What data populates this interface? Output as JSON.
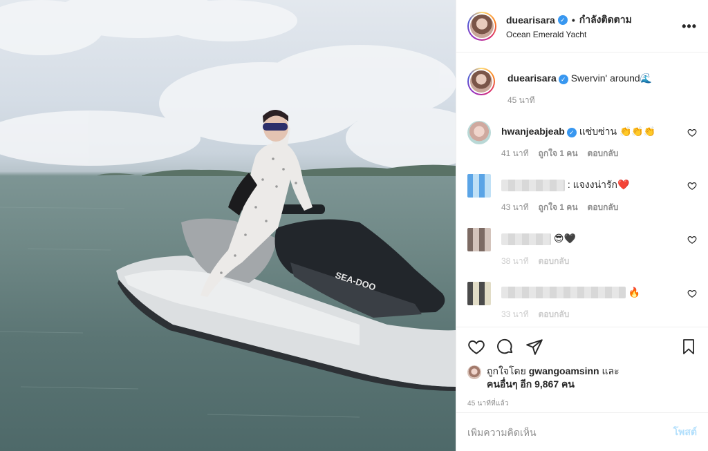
{
  "post": {
    "author": "duearisara",
    "follow_state": "กำลังติดตาม",
    "location": "Ocean Emerald Yacht",
    "caption": "Swervin' around🌊",
    "caption_time": "45 นาที"
  },
  "photo_overlay": {
    "jetski_brand": "SEA-DOO"
  },
  "comments": [
    {
      "user": "hwanjeabjeab",
      "text": "แซ่บซ่าน 👏👏👏",
      "time": "41 นาที",
      "likes": "ถูกใจ 1 คน",
      "reply": "ตอบกลับ"
    },
    {
      "user": "",
      "text": ": แจงงน่ารัก❤️",
      "time": "43 นาที",
      "likes": "ถูกใจ 1 คน",
      "reply": "ตอบกลับ"
    },
    {
      "user": "",
      "text": "😎🖤",
      "time": "38 นาที",
      "reply": "ตอบกลับ"
    },
    {
      "user": "",
      "text": "🔥",
      "time": "33 นาที",
      "reply": "ตอบกลับ"
    }
  ],
  "likes": {
    "prefix": "ถูกใจโดย",
    "user": "gwangoamsinn",
    "connector": "และ",
    "others": "คนอื่นๆ อีก 9,867 คน"
  },
  "time_ago": "45 นาทีที่แล้ว",
  "add_comment": {
    "placeholder": "เพิ่มความคิดเห็น",
    "post_label": "โพสต์"
  },
  "icons": [
    "heart-icon",
    "comment-icon",
    "share-icon",
    "bookmark-icon",
    "more-icon",
    "verified-badge-icon"
  ],
  "colors": {
    "verified": "#3897f0",
    "post_button_disabled": "#b2dffc",
    "muted": "#8e8e8e"
  }
}
